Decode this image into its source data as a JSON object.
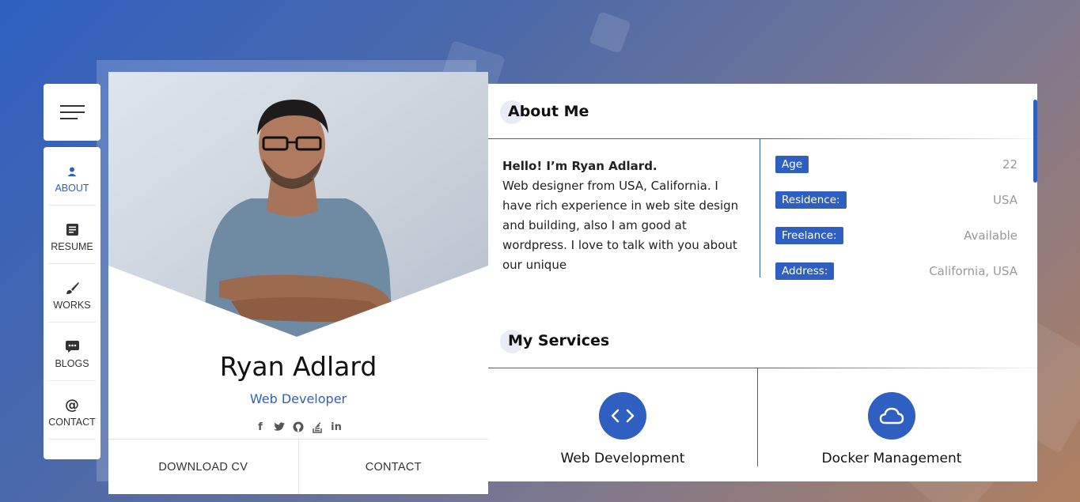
{
  "menu": {
    "icon": "hamburger-icon"
  },
  "nav": {
    "items": [
      {
        "label": "ABOUT",
        "icon": "user-icon",
        "active": true
      },
      {
        "label": "RESUME",
        "icon": "document-icon",
        "active": false
      },
      {
        "label": "WORKS",
        "icon": "paintbrush-icon",
        "active": false
      },
      {
        "label": "BLOGS",
        "icon": "chat-icon",
        "active": false
      },
      {
        "label": "CONTACT",
        "icon": "at-icon",
        "active": false
      }
    ]
  },
  "profile": {
    "name": "Ryan Adlard",
    "role": "Web Developer",
    "socials": [
      "facebook-icon",
      "twitter-icon",
      "github-icon",
      "stackoverflow-icon",
      "linkedin-icon"
    ],
    "download_label": "DOWNLOAD CV",
    "contact_label": "CONTACT"
  },
  "about": {
    "title": "About Me",
    "greeting": "Hello! I’m Ryan Adlard.",
    "bio": "Web designer from USA, California. I have rich experience in web site design and building, also I am good at wordpress. I love to talk with you about our unique",
    "info": [
      {
        "label": "Age",
        "value": "22"
      },
      {
        "label": "Residence:",
        "value": "USA"
      },
      {
        "label": "Freelance:",
        "value": "Available"
      },
      {
        "label": "Address:",
        "value": "California, USA"
      }
    ]
  },
  "services": {
    "title": "My Services",
    "items": [
      {
        "title": "Web Development",
        "icon": "code-icon"
      },
      {
        "title": "Docker Management",
        "icon": "cloud-icon"
      }
    ]
  },
  "colors": {
    "accent": "#2f5fc0"
  }
}
